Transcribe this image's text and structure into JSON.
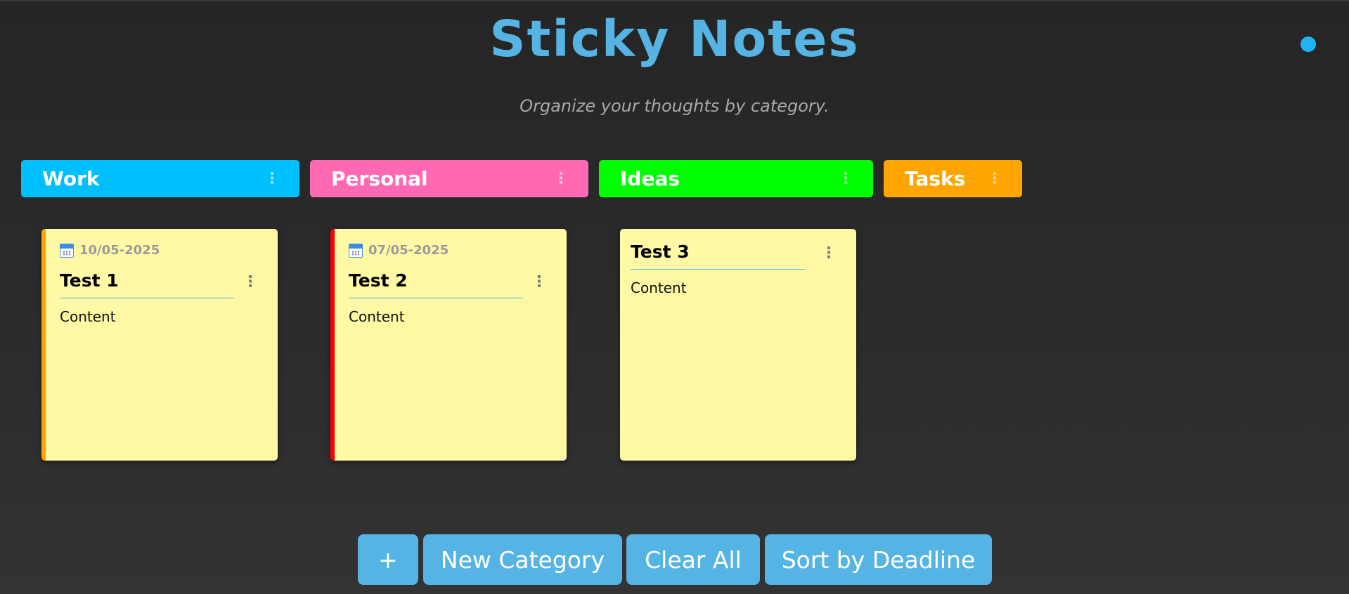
{
  "header": {
    "title": "Sticky Notes",
    "subtitle": "Organize your thoughts by category.",
    "theme_toggle_color": "#1eb4f4"
  },
  "categories": [
    {
      "label": "Work",
      "color": "#00bfff",
      "menu_icon": "vertical-dots-icon"
    },
    {
      "label": "Personal",
      "color": "#ff69b4",
      "menu_icon": "vertical-dots-icon"
    },
    {
      "label": "Ideas",
      "color": "#00ff00",
      "menu_icon": "vertical-dots-icon"
    },
    {
      "label": "Tasks",
      "color": "#ffa500",
      "menu_icon": "vertical-dots-icon"
    }
  ],
  "notes": [
    {
      "date": "10/05-2025",
      "title": "Test 1",
      "content": "Content",
      "stripe_color": "#ffa500",
      "date_icon": "calendar-icon"
    },
    {
      "date": "07/05-2025",
      "title": "Test 2",
      "content": "Content",
      "stripe_color": "#ff0000",
      "date_icon": "calendar-icon"
    },
    {
      "title": "Test 3",
      "content": "Content"
    }
  ],
  "toolbar": {
    "add_label": "+",
    "new_category_label": "New Category",
    "clear_all_label": "Clear All",
    "sort_label": "Sort by Deadline"
  },
  "colors": {
    "accent": "#56b4e4",
    "note_background": "#fff9a6"
  }
}
